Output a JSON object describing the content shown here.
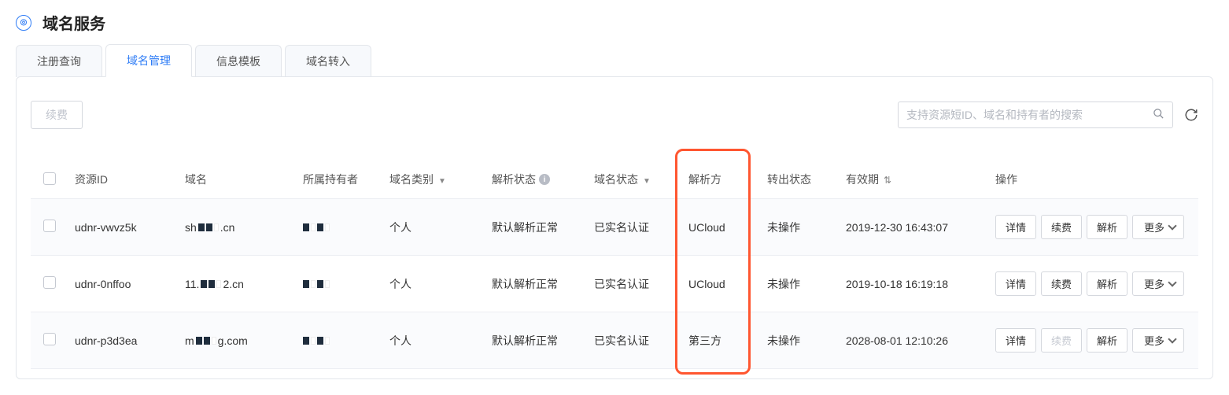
{
  "header": {
    "title": "域名服务"
  },
  "tabs": [
    {
      "label": "注册查询",
      "active": false
    },
    {
      "label": "域名管理",
      "active": true
    },
    {
      "label": "信息模板",
      "active": false
    },
    {
      "label": "域名转入",
      "active": false
    }
  ],
  "toolbar": {
    "renew_label": "续费",
    "search_placeholder": "支持资源短ID、域名和持有者的搜索"
  },
  "columns": {
    "resource_id": "资源ID",
    "domain": "域名",
    "owner": "所属持有者",
    "domain_type": "域名类别",
    "resolve_status": "解析状态",
    "domain_status": "域名状态",
    "resolver": "解析方",
    "transfer_status": "转出状态",
    "expire": "有效期",
    "ops": "操作"
  },
  "action_labels": {
    "detail": "详情",
    "renew": "续费",
    "resolve": "解析",
    "more": "更多"
  },
  "rows": [
    {
      "resource_id": "udnr-vwvz5k",
      "domain_prefix": "sh",
      "domain_suffix": ".cn",
      "domain_type": "个人",
      "resolve_status": "默认解析正常",
      "domain_status": "已实名认证",
      "resolver": "UCloud",
      "transfer_status": "未操作",
      "expire": "2019-12-30 16:43:07",
      "renew_disabled": false
    },
    {
      "resource_id": "udnr-0nffoo",
      "domain_prefix": "11.",
      "domain_suffix": "2.cn",
      "domain_type": "个人",
      "resolve_status": "默认解析正常",
      "domain_status": "已实名认证",
      "resolver": "UCloud",
      "transfer_status": "未操作",
      "expire": "2019-10-18 16:19:18",
      "renew_disabled": false
    },
    {
      "resource_id": "udnr-p3d3ea",
      "domain_prefix": "m",
      "domain_suffix": "g.com",
      "domain_type": "个人",
      "resolve_status": "默认解析正常",
      "domain_status": "已实名认证",
      "resolver": "第三方",
      "transfer_status": "未操作",
      "expire": "2028-08-01 12:10:26",
      "renew_disabled": true
    }
  ]
}
